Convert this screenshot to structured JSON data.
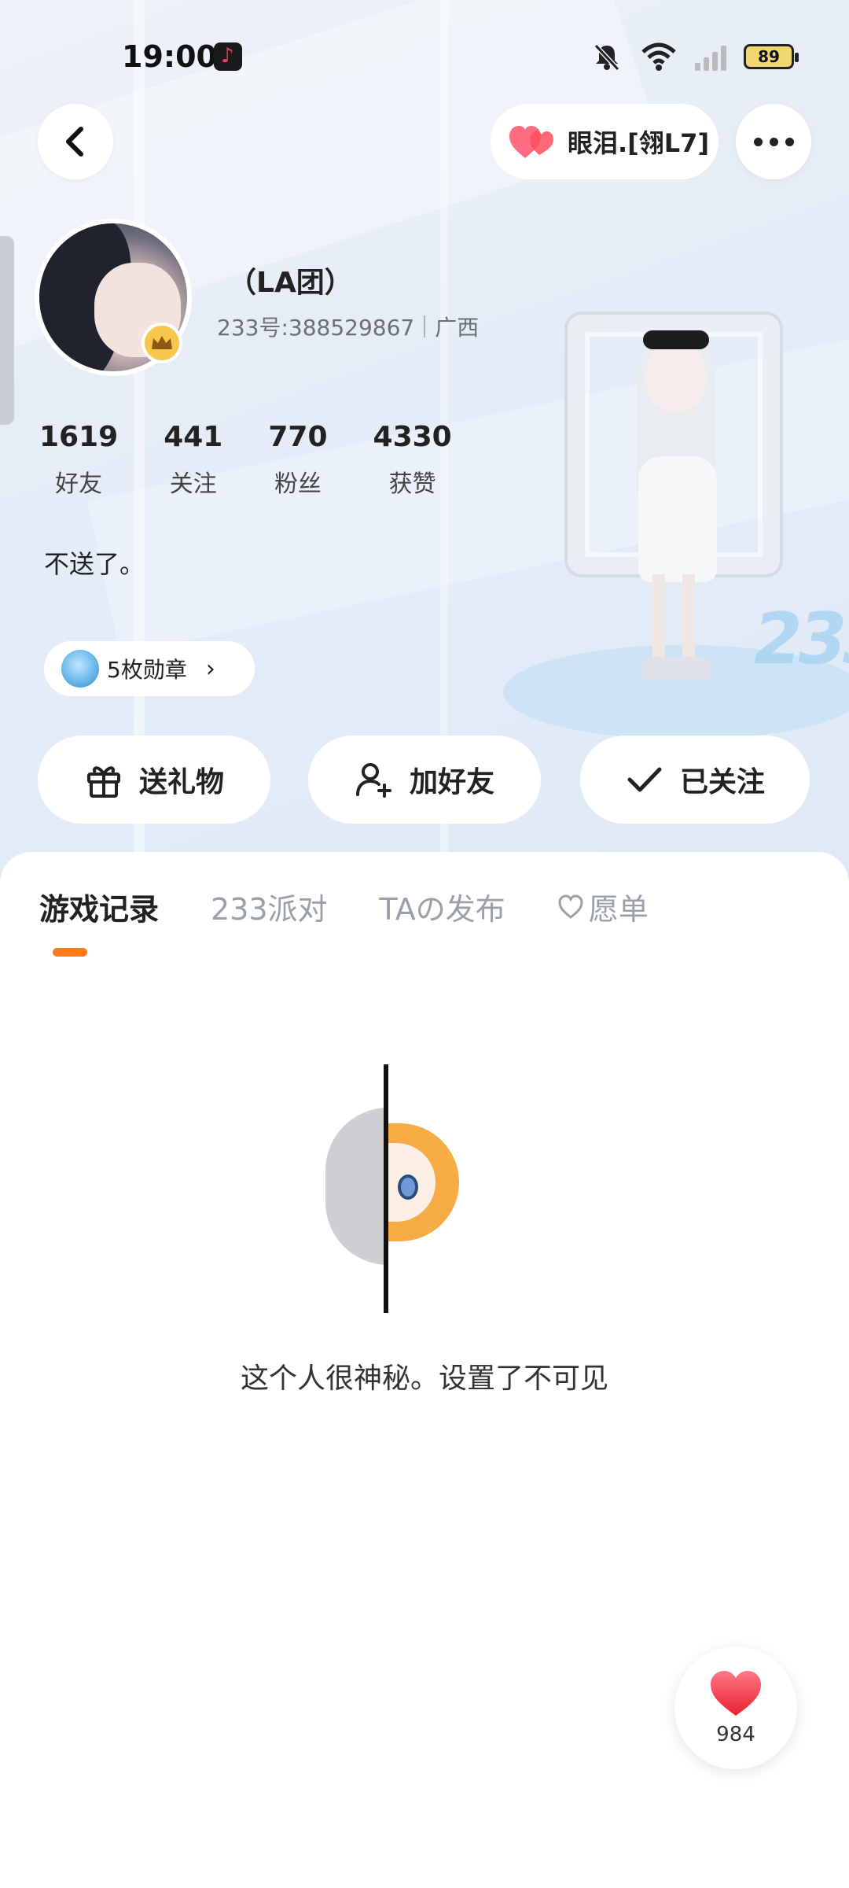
{
  "status_bar": {
    "time": "19:00",
    "battery": "89"
  },
  "header": {
    "pair_name": "眼泪.[翎L7]"
  },
  "profile": {
    "nickname": "（LA团）",
    "id_label": "233号:388529867",
    "region": "广西",
    "stats": [
      {
        "value": "1619",
        "label": "好友"
      },
      {
        "value": "441",
        "label": "关注"
      },
      {
        "value": "770",
        "label": "粉丝"
      },
      {
        "value": "4330",
        "label": "获赞"
      }
    ],
    "bio": "不送了。",
    "badges_label": "5枚勋章"
  },
  "actions": {
    "gift": "送礼物",
    "add_friend": "加好友",
    "following": "已关注"
  },
  "tabs": [
    {
      "label": "游戏记录",
      "active": true
    },
    {
      "label": "233派对",
      "active": false
    },
    {
      "label": "TAの发布",
      "active": false
    },
    {
      "label": "愿单",
      "active": false,
      "icon": "heart-outline-icon"
    }
  ],
  "empty_state": {
    "message": "这个人很神秘。设置了不可见"
  },
  "like_fab": {
    "count": "984"
  },
  "colors": {
    "accent": "#ff7a1a",
    "heart": "#ff4d5e",
    "crown": "#f7c64a"
  }
}
